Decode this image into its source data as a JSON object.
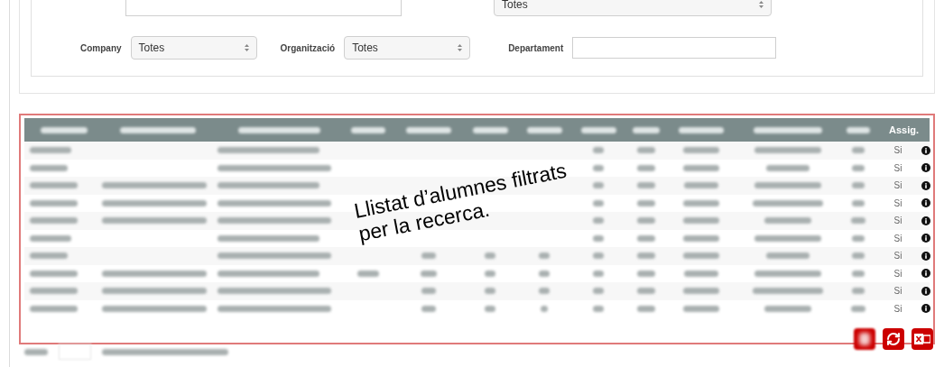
{
  "top_row": {
    "select_value": "Totes"
  },
  "filters": [
    {
      "kind": "select",
      "label": "Company",
      "value": "Totes"
    },
    {
      "kind": "select",
      "label": "Organització",
      "value": "Totes"
    },
    {
      "kind": "text",
      "label": "Departament"
    }
  ],
  "table": {
    "assign_column": "Assig.",
    "rows": [
      {
        "assigned": "Si"
      },
      {
        "assigned": "Si"
      },
      {
        "assigned": "Si"
      },
      {
        "assigned": "Si"
      },
      {
        "assigned": "Si"
      },
      {
        "assigned": "Si"
      },
      {
        "assigned": "Si"
      },
      {
        "assigned": "Si"
      },
      {
        "assigned": "Si"
      },
      {
        "assigned": "Si"
      }
    ]
  },
  "annotation": {
    "lines": [
      "Llistat d’alumnes filtrats",
      "per la recerca."
    ]
  },
  "actions": [
    {
      "kind": "blurred"
    },
    {
      "kind": "refresh"
    },
    {
      "kind": "excel"
    }
  ]
}
